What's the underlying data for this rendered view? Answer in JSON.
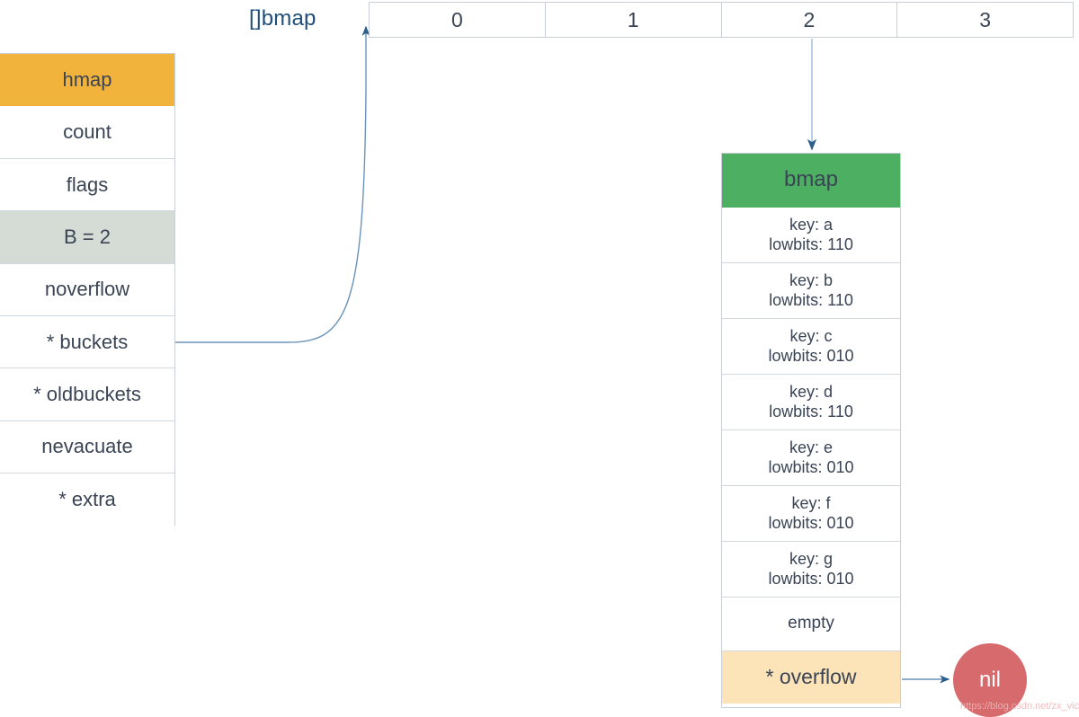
{
  "diagram": {
    "title_label": "[]bmap",
    "colors": {
      "hmap_header": "#f2b33d",
      "hmap_highlight": "#d5dcd6",
      "bmap_header": "#4caf61",
      "overflow": "#fce3b8",
      "nil": "#d76a6d",
      "text": "#3a4454",
      "label": "#1f4e79",
      "connector": "#6b93b8"
    }
  },
  "hmap": {
    "header": "hmap",
    "fields": [
      {
        "label": "count",
        "highlight": false
      },
      {
        "label": "flags",
        "highlight": false
      },
      {
        "label": "B = 2",
        "highlight": true
      },
      {
        "label": "noverflow",
        "highlight": false
      },
      {
        "label": "* buckets",
        "highlight": false
      },
      {
        "label": "* oldbuckets",
        "highlight": false
      },
      {
        "label": "nevacuate",
        "highlight": false
      },
      {
        "label": "* extra",
        "highlight": false
      }
    ]
  },
  "bucket_array": {
    "label": "[]bmap",
    "cells": [
      "0",
      "1",
      "2",
      "3"
    ],
    "pointed_index": 2
  },
  "bmap": {
    "header": "bmap",
    "entries": [
      {
        "key": "key: a",
        "lowbits": "lowbits: 110"
      },
      {
        "key": "key: b",
        "lowbits": "lowbits: 110"
      },
      {
        "key": "key: c",
        "lowbits": "lowbits: 010"
      },
      {
        "key": "key: d",
        "lowbits": "lowbits: 110"
      },
      {
        "key": "key: e",
        "lowbits": "lowbits: 010"
      },
      {
        "key": "key: f",
        "lowbits": "lowbits: 010"
      },
      {
        "key": "key: g",
        "lowbits": "lowbits: 010"
      }
    ],
    "empty_label": "empty",
    "overflow_label": "* overflow"
  },
  "nil_node": {
    "label": "nil"
  },
  "watermark": {
    "text": "https://blog.csdn.net/zx_victory"
  }
}
